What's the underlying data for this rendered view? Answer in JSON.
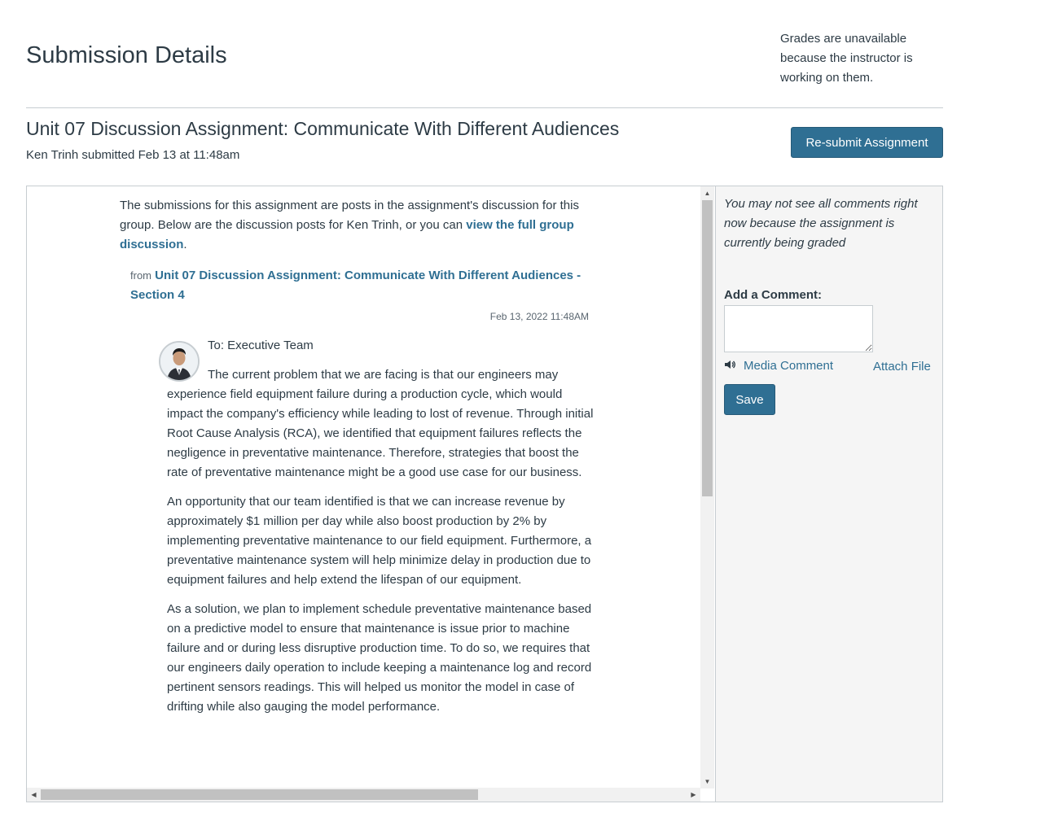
{
  "header": {
    "title": "Submission Details",
    "grades_note": "Grades are unavailable because the instructor is working on them."
  },
  "assignment": {
    "title": "Unit 07 Discussion Assignment: Communicate With Different Audiences",
    "submitted": "Ken Trinh submitted Feb 13 at 11:48am",
    "resubmit_label": "Re-submit Assignment"
  },
  "submission": {
    "intro_text": "The submissions for this assignment are posts in the assignment's discussion for this group. Below are the discussion posts for Ken Trinh, or you can ",
    "intro_link": "view the full group discussion",
    "intro_end": ".",
    "from_label": "from",
    "from_link": "Unit 07 Discussion Assignment: Communicate With Different Audiences - Section 4",
    "post_date": "Feb 13, 2022 11:48AM",
    "post": {
      "to_line": "To: Executive Team",
      "paragraphs": [
        "The current problem that we are facing is that our engineers may experience field equipment failure during a production cycle, which would impact the company's efficiency while leading to lost of revenue. Through initial Root Cause Analysis (RCA), we identified that equipment failures reflects the negligence in preventative maintenance. Therefore, strategies that boost the rate of preventative maintenance might be a good use case for our business.",
        "An opportunity that our team identified is that we can increase revenue by approximately $1 million per day while also boost production by 2% by implementing preventative maintenance to our field equipment. Furthermore, a preventative maintenance system will help minimize delay in production due to equipment failures and help extend the lifespan of our equipment.",
        "As a solution, we plan to implement schedule preventative maintenance based on a predictive model to ensure that maintenance is issue prior to machine failure and or during less disruptive production time. To do so, we requires that our engineers daily operation to include keeping a maintenance log and record pertinent sensors readings. This will helped us monitor the model in case of drifting while also gauging the model performance."
      ]
    }
  },
  "comments": {
    "grading_note": "You may not see all comments right now because the assignment is currently being graded",
    "add_comment_label": "Add a Comment:",
    "comment_value": "",
    "media_comment_label": "Media Comment",
    "attach_file_label": "Attach File",
    "save_label": "Save"
  },
  "icons": {
    "media": "speaker-icon",
    "avatar": "user-avatar"
  },
  "colors": {
    "accent": "#2f6f93",
    "text": "#2d3b45",
    "panel_bg": "#f5f5f5"
  }
}
